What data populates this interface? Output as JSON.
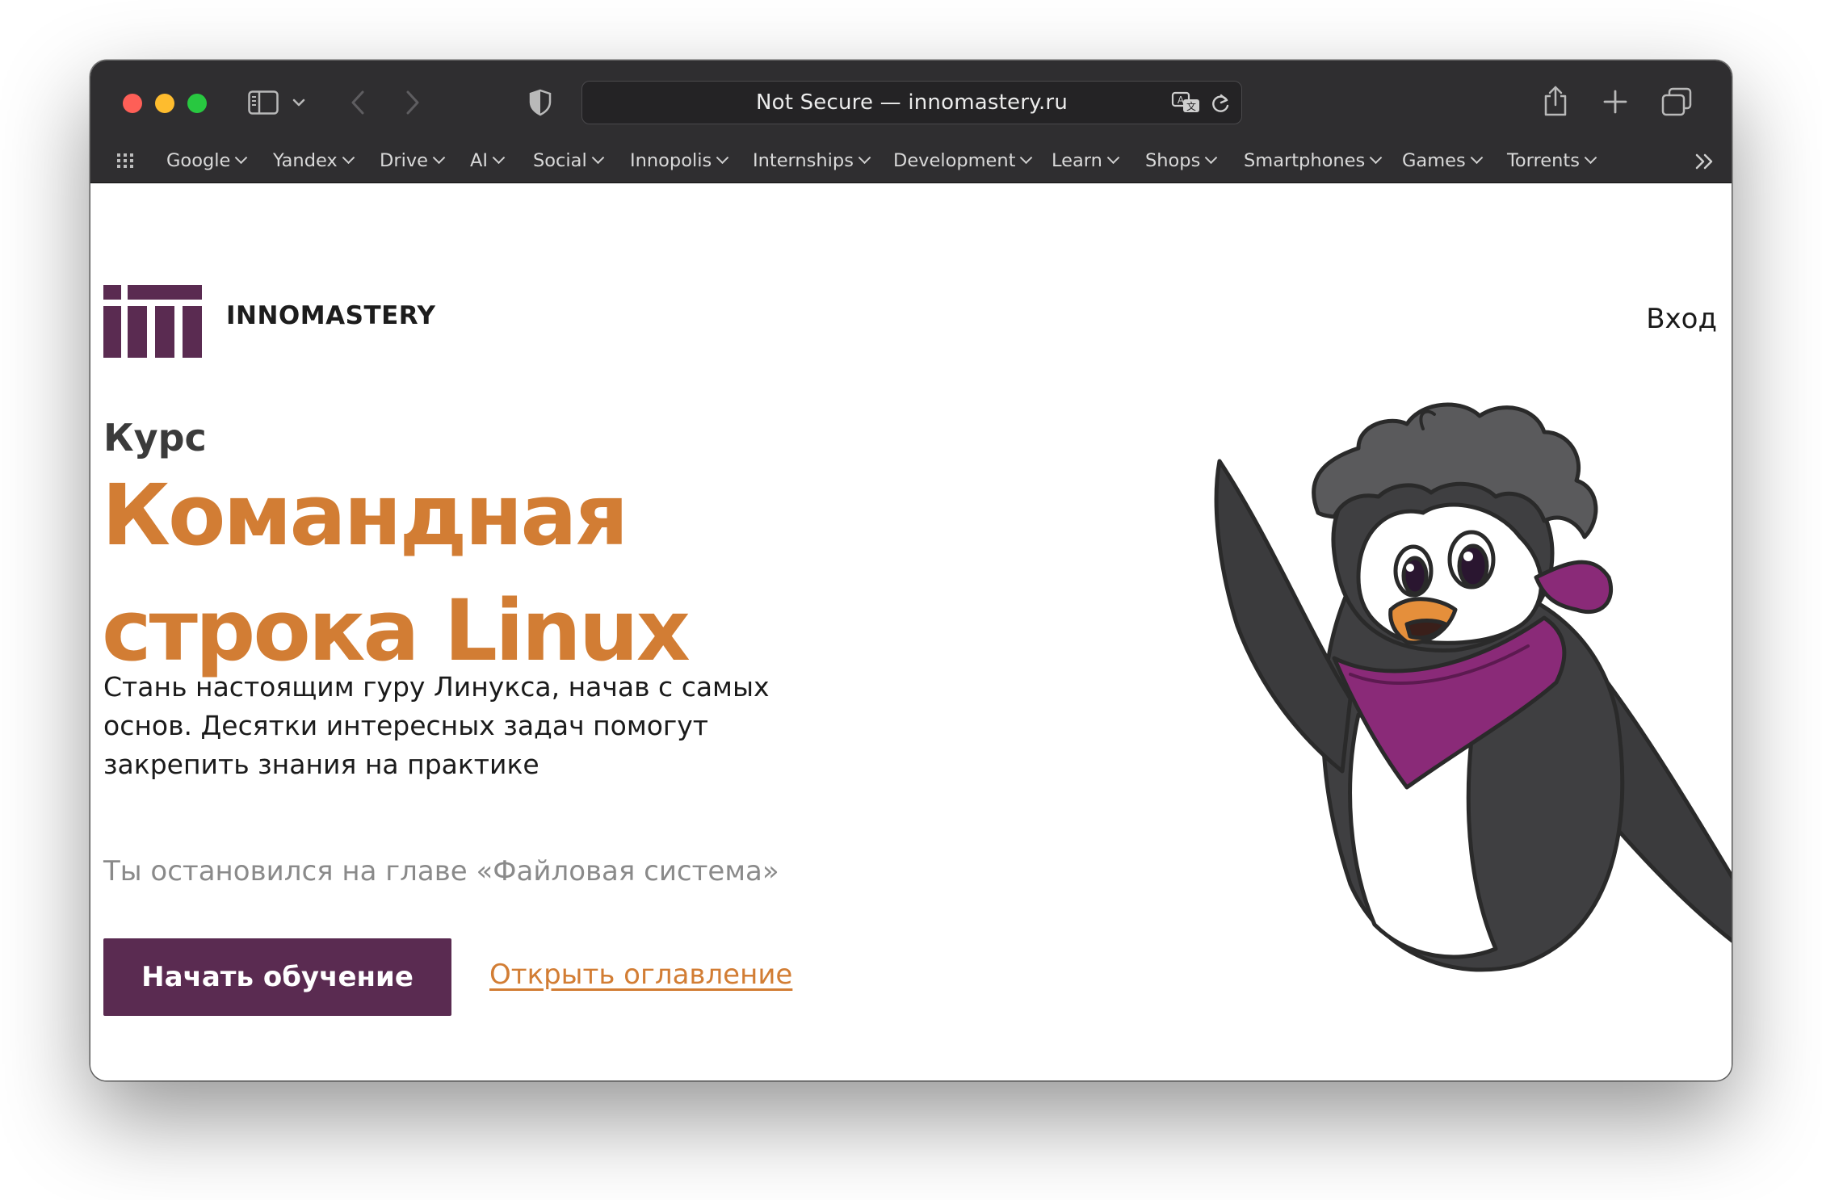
{
  "browser": {
    "url_text": "Not Secure — innomastery.ru",
    "bookmarks": [
      {
        "label": "Google"
      },
      {
        "label": "Yandex"
      },
      {
        "label": "Drive"
      },
      {
        "label": "AI"
      },
      {
        "label": "Social"
      },
      {
        "label": "Innopolis"
      },
      {
        "label": "Internships"
      },
      {
        "label": "Development"
      },
      {
        "label": "Learn"
      },
      {
        "label": "Shops"
      },
      {
        "label": "Smartphones"
      },
      {
        "label": "Games"
      },
      {
        "label": "Torrents"
      }
    ]
  },
  "header": {
    "brand": "INNOMASTERY",
    "login": "Вход"
  },
  "hero": {
    "kicker": "Курс",
    "title_line1": "Командная",
    "title_line2": "строка Linux",
    "description": "Стань настоящим гуру Линукса, начав с самых основ. Десятки интересных задач помогут закрепить знания на практике",
    "resume_text": "Ты остановился на главе «Файловая система»",
    "start_button": "Начать обучение",
    "toc_link": "Открыть оглавление"
  },
  "colors": {
    "brand_purple": "#5a2b51",
    "accent_orange": "#d27d34",
    "toolbar_bg": "#2f2e30"
  },
  "icons": [
    "sidebar-icon",
    "chevron-down-icon",
    "back-arrow-icon",
    "forward-arrow-icon",
    "shield-icon",
    "translate-icon",
    "reload-icon",
    "share-icon",
    "plus-icon",
    "tabs-overview-icon",
    "grid-icon",
    "double-chevron-icon"
  ]
}
